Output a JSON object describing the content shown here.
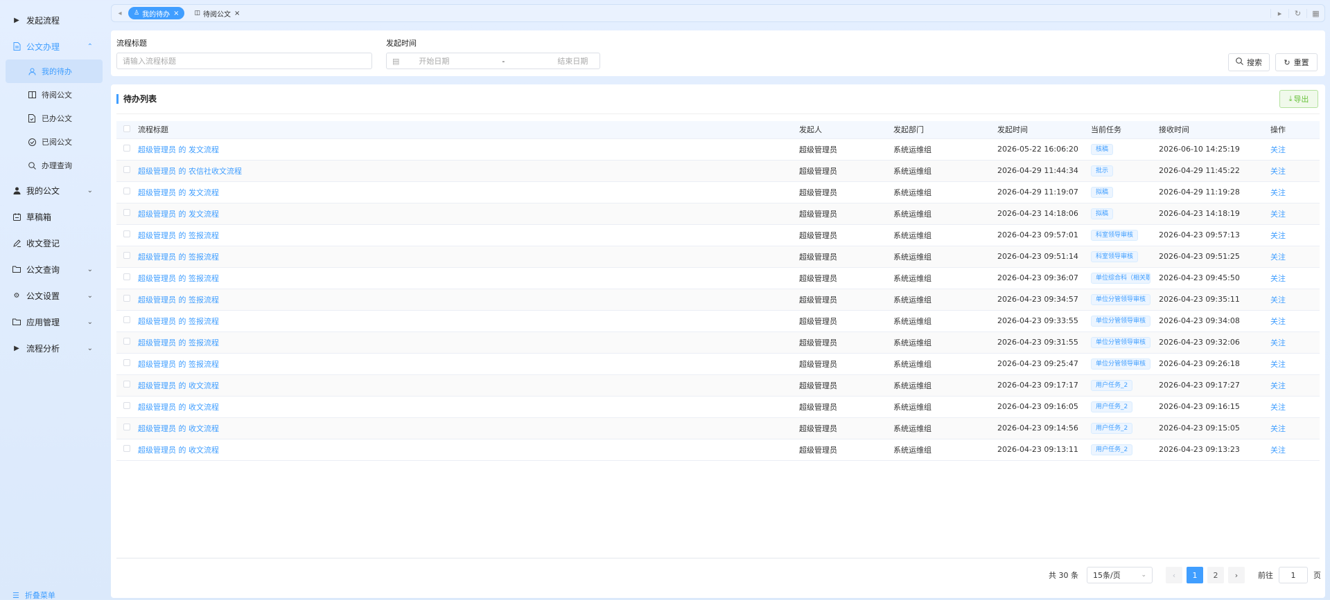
{
  "sidebar": {
    "items": [
      {
        "label": "发起流程",
        "icon": "caret-right-icon"
      },
      {
        "label": "公文办理",
        "icon": "document-icon"
      },
      {
        "label": "我的公文",
        "icon": "user-icon"
      },
      {
        "label": "草稿箱",
        "icon": "draft-box-icon"
      },
      {
        "label": "收文登记",
        "icon": "edit-pen-icon"
      },
      {
        "label": "公文查询",
        "icon": "folder-icon"
      },
      {
        "label": "公文设置",
        "icon": "gear-icon"
      },
      {
        "label": "应用管理",
        "icon": "folder-icon"
      },
      {
        "label": "流程分析",
        "icon": "caret-right-icon"
      }
    ],
    "sub_items": [
      {
        "label": "我的待办",
        "icon": "user-icon"
      },
      {
        "label": "待阅公文",
        "icon": "book-icon"
      },
      {
        "label": "已办公文",
        "icon": "document-check-icon"
      },
      {
        "label": "已阅公文",
        "icon": "circle-check-icon"
      },
      {
        "label": "办理查询",
        "icon": "search-icon"
      }
    ],
    "collapse_label": "折叠菜单"
  },
  "tabs": [
    {
      "label": "我的待办",
      "icon": "user-icon",
      "active": true
    },
    {
      "label": "待阅公文",
      "icon": "book-icon",
      "active": false
    }
  ],
  "search": {
    "title_label": "流程标题",
    "title_placeholder": "请输入流程标题",
    "time_label": "发起时间",
    "start_placeholder": "开始日期",
    "range_sep": "-",
    "end_placeholder": "结束日期",
    "search_button": "搜索",
    "reset_button": "重置"
  },
  "list": {
    "title": "待办列表",
    "export_button": "导出",
    "columns": [
      "流程标题",
      "发起人",
      "发起部门",
      "发起时间",
      "当前任务",
      "接收时间",
      "操作"
    ],
    "rows": [
      [
        "超级管理员 的 发文流程",
        "超级管理员",
        "系统运维组",
        "2026-05-22 16:06:20",
        "核稿",
        "2026-06-10 14:25:19",
        "关注"
      ],
      [
        "超级管理员 的 农信社收文流程",
        "超级管理员",
        "系统运维组",
        "2026-04-29 11:44:34",
        "批示",
        "2026-04-29 11:45:22",
        "关注"
      ],
      [
        "超级管理员 的 发文流程",
        "超级管理员",
        "系统运维组",
        "2026-04-29 11:19:07",
        "拟稿",
        "2026-04-29 11:19:28",
        "关注"
      ],
      [
        "超级管理员 的 发文流程",
        "超级管理员",
        "系统运维组",
        "2026-04-23 14:18:06",
        "拟稿",
        "2026-04-23 14:18:19",
        "关注"
      ],
      [
        "超级管理员 的 签报流程",
        "超级管理员",
        "系统运维组",
        "2026-04-23 09:57:01",
        "科室领导审核",
        "2026-04-23 09:57:13",
        "关注"
      ],
      [
        "超级管理员 的 签报流程",
        "超级管理员",
        "系统运维组",
        "2026-04-23 09:51:14",
        "科室领导审核",
        "2026-04-23 09:51:25",
        "关注"
      ],
      [
        "超级管理员 的 签报流程",
        "超级管理员",
        "系统运维组",
        "2026-04-23 09:36:07",
        "单位综合科（相关职",
        "2026-04-23 09:45:50",
        "关注"
      ],
      [
        "超级管理员 的 签报流程",
        "超级管理员",
        "系统运维组",
        "2026-04-23 09:34:57",
        "单位分管领导审核",
        "2026-04-23 09:35:11",
        "关注"
      ],
      [
        "超级管理员 的 签报流程",
        "超级管理员",
        "系统运维组",
        "2026-04-23 09:33:55",
        "单位分管领导审核",
        "2026-04-23 09:34:08",
        "关注"
      ],
      [
        "超级管理员 的 签报流程",
        "超级管理员",
        "系统运维组",
        "2026-04-23 09:31:55",
        "单位分管领导审核",
        "2026-04-23 09:32:06",
        "关注"
      ],
      [
        "超级管理员 的 签报流程",
        "超级管理员",
        "系统运维组",
        "2026-04-23 09:25:47",
        "单位分管领导审核",
        "2026-04-23 09:26:18",
        "关注"
      ],
      [
        "超级管理员 的 收文流程",
        "超级管理员",
        "系统运维组",
        "2026-04-23 09:17:17",
        "用户任务_2",
        "2026-04-23 09:17:27",
        "关注"
      ],
      [
        "超级管理员 的 收文流程",
        "超级管理员",
        "系统运维组",
        "2026-04-23 09:16:05",
        "用户任务_2",
        "2026-04-23 09:16:15",
        "关注"
      ],
      [
        "超级管理员 的 收文流程",
        "超级管理员",
        "系统运维组",
        "2026-04-23 09:14:56",
        "用户任务_2",
        "2026-04-23 09:15:05",
        "关注"
      ],
      [
        "超级管理员 的 收文流程",
        "超级管理员",
        "系统运维组",
        "2026-04-23 09:13:11",
        "用户任务_2",
        "2026-04-23 09:13:23",
        "关注"
      ]
    ]
  },
  "pagination": {
    "total": "共 30 条",
    "page_size": "15条/页",
    "pages": [
      "1",
      "2"
    ],
    "current_page": "1",
    "goto_label": "前往",
    "goto_value": "1",
    "goto_suffix": "页"
  },
  "colors": {
    "accent": "#409eff",
    "export": "#67c23a"
  }
}
